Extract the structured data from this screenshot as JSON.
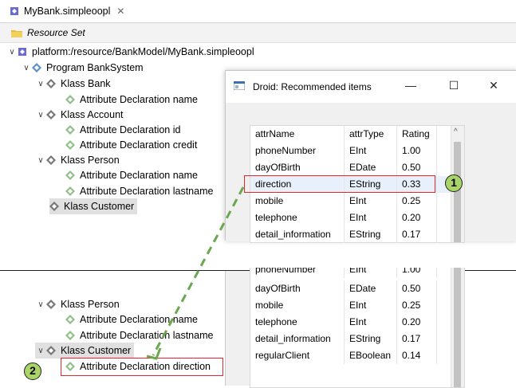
{
  "editor": {
    "tab_title": "MyBank.simpleoopl",
    "tab_close": "✕",
    "resource_set": "Resource Set"
  },
  "tree_top": {
    "root": "platform:/resource/BankModel/MyBank.simpleoopl",
    "program": "Program BankSystem",
    "bank": "Klass Bank",
    "bank_attr_name": "Attribute Declaration name",
    "account": "Klass Account",
    "account_attr_id": "Attribute Declaration id",
    "account_attr_credit": "Attribute Declaration credit",
    "person": "Klass Person",
    "person_attr_name": "Attribute Declaration name",
    "person_attr_lastname": "Attribute Declaration lastname",
    "customer": "Klass Customer"
  },
  "dialog": {
    "title": "Droid: Recommended items",
    "minimize": "—",
    "maximize": "☐",
    "close": "✕",
    "columns": [
      "attrName",
      "attrType",
      "Rating"
    ],
    "rows": [
      [
        "phoneNumber",
        "EInt",
        "1.00"
      ],
      [
        "dayOfBirth",
        "EDate",
        "0.50"
      ],
      [
        "direction",
        "EString",
        "0.33"
      ],
      [
        "mobile",
        "EInt",
        "0.25"
      ],
      [
        "telephone",
        "EInt",
        "0.20"
      ],
      [
        "detail_information",
        "EString",
        "0.17"
      ]
    ]
  },
  "tree_bottom": {
    "person": "Klass Person",
    "person_attr_name": "Attribute Declaration name",
    "person_attr_lastname": "Attribute Declaration lastname",
    "customer": "Klass Customer",
    "customer_attr_direction": "Attribute Declaration direction"
  },
  "table_bottom": {
    "rows": [
      [
        "phoneNumber",
        "EInt",
        "1.00"
      ],
      [
        "dayOfBirth",
        "EDate",
        "0.50"
      ],
      [
        "mobile",
        "EInt",
        "0.25"
      ],
      [
        "telephone",
        "EInt",
        "0.20"
      ],
      [
        "detail_information",
        "EString",
        "0.17"
      ],
      [
        "regularClient",
        "EBoolean",
        "0.14"
      ]
    ]
  },
  "annotations": {
    "step1": "1",
    "step2": "2"
  },
  "colors": {
    "highlight_box": "#e0292c",
    "badge_fill": "#a8d468",
    "arrow": "#6aa84f"
  }
}
